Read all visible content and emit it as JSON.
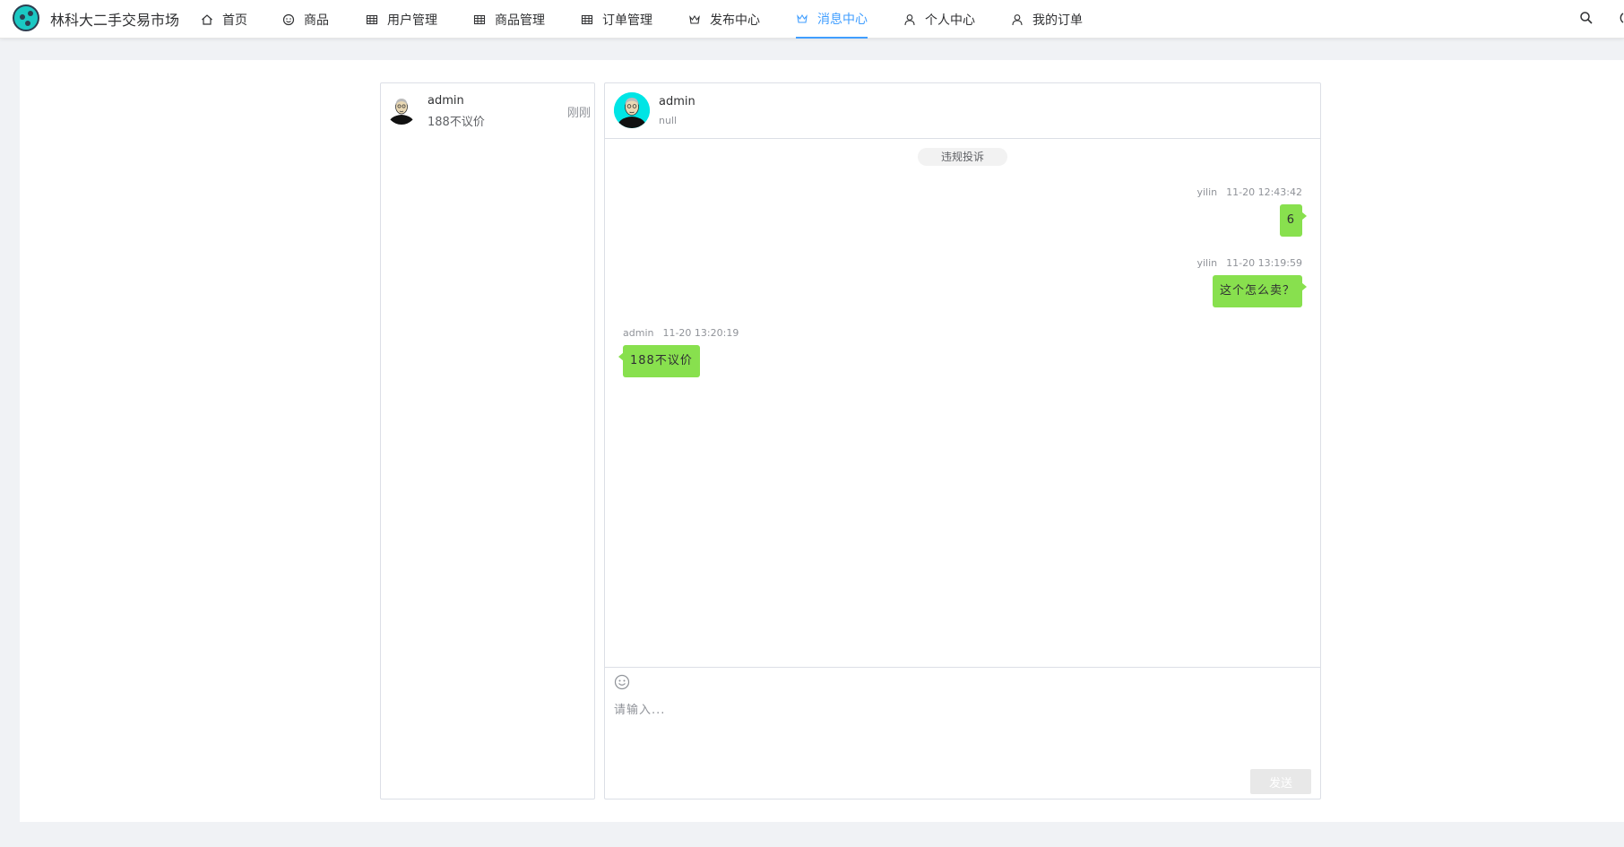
{
  "app": {
    "brand": "林科大二手交易市场"
  },
  "nav": {
    "items": [
      {
        "label": "首页",
        "icon": "home-icon"
      },
      {
        "label": "商品",
        "icon": "smile-icon"
      },
      {
        "label": "用户管理",
        "icon": "grid-icon"
      },
      {
        "label": "商品管理",
        "icon": "grid-icon"
      },
      {
        "label": "订单管理",
        "icon": "grid-icon"
      },
      {
        "label": "发布中心",
        "icon": "crown-icon"
      },
      {
        "label": "消息中心",
        "icon": "crown-icon",
        "active": true
      },
      {
        "label": "个人中心",
        "icon": "user-icon"
      },
      {
        "label": "我的订单",
        "icon": "user-icon"
      }
    ],
    "active_color": "#409eff"
  },
  "conversations": [
    {
      "name": "admin",
      "preview": "188不议价",
      "time": "刚刚"
    }
  ],
  "chat": {
    "peer_name": "admin",
    "peer_status": "null",
    "complaint_label": "违规投诉",
    "messages": [
      {
        "sender": "yilin",
        "time": "11-20 12:43:42",
        "text": "6",
        "side": "right"
      },
      {
        "sender": "yilin",
        "time": "11-20 13:19:59",
        "text": "这个怎么卖？",
        "side": "right"
      },
      {
        "sender": "admin",
        "time": "11-20 13:20:19",
        "text": "188不议价",
        "side": "left"
      }
    ],
    "bubble_color": "#88e04e"
  },
  "composer": {
    "placeholder": "请输入...",
    "send_label": "发送"
  }
}
